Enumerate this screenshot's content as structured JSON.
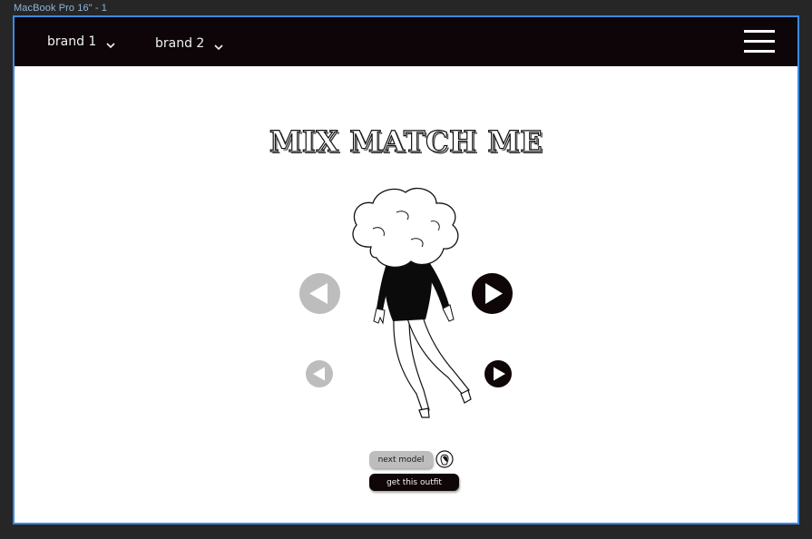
{
  "frame": {
    "label": "MacBook Pro 16\" - 1"
  },
  "navbar": {
    "brand1_label": "brand 1",
    "brand2_label": "brand 2",
    "menu_icon": "hamburger-menu-icon",
    "background": "#0d0507"
  },
  "main": {
    "title": "MIX MATCH ME",
    "top_prev_icon": "play-left-icon",
    "top_next_icon": "play-right-icon",
    "bottom_prev_icon": "play-left-icon",
    "bottom_next_icon": "play-right-icon",
    "next_model_label": "next model",
    "model_icon": "model-avatar-icon",
    "get_outfit_label": "get this outfit"
  },
  "colors": {
    "accent_dark": "#0f0607",
    "disabled_grey": "#bdbdbd",
    "frame_outline": "#3d8ae0"
  }
}
